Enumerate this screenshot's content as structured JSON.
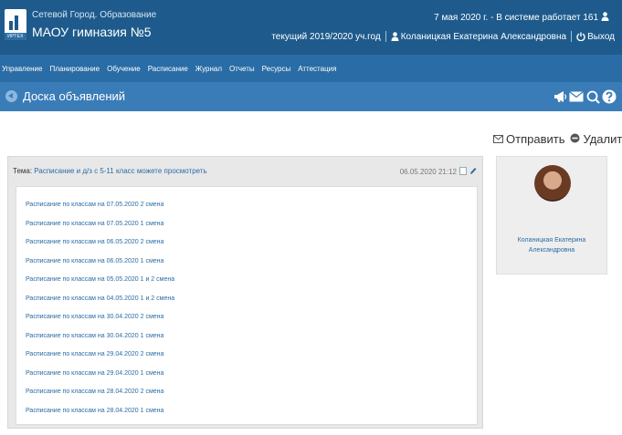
{
  "header": {
    "app_name": "Сетевой Город. Образование",
    "logo_text": "ИРТЕХ",
    "school_name": "МАОУ гимназия №5",
    "status_text": "7 мая 2020 г. - В системе работает 161",
    "academic_year": "текущий 2019/2020 уч.год",
    "user_name": "Коланицкая Екатерина Александровна",
    "logout_label": "Выход"
  },
  "menu": {
    "items": [
      "Управление",
      "Планирование",
      "Обучение",
      "Расписание",
      "Журнал",
      "Отчеты",
      "Ресурсы",
      "Аттестация"
    ]
  },
  "page": {
    "title": "Доска объявлений"
  },
  "actions": {
    "send_label": "Отправить",
    "delete_label": "Удалить"
  },
  "announcement": {
    "topic_label": "Тема:",
    "topic": "Расписание и д/з с 5-11 класс можете просмотреть",
    "date": "06.05.2020 21:12",
    "links": [
      "Расписание по классам на 07.05.2020 2 смена",
      "Расписание по классам на 07.05.2020 1 смена",
      "Расписание по классам на 06.05.2020 2 смена",
      "Расписание по классам на 06.05.2020 1 смена",
      "Расписание по классам на 05.05.2020 1 и 2 смена",
      "Расписание по классам на 04.05.2020 1 и 2 смена",
      "Расписание по классам на 30.04.2020 2 смена",
      "Расписание по классам на 30.04.2020 1 смена",
      "Расписание по классам на 29.04.2020 2 смена",
      "Расписание по классам на 29.04.2020 1 смена",
      "Расписание по классам на 28.04.2020 2 смена",
      "Расписание по классам на 28.04.2020 1 смена"
    ]
  },
  "author": {
    "name": "Коланицкая Екатерина Александровна"
  },
  "icons": {
    "back": "back-arrow-icon",
    "megaphone": "megaphone-icon",
    "mail": "mail-icon",
    "chat": "chat-icon",
    "help": "help-icon",
    "user": "user-icon",
    "power": "power-icon",
    "send": "envelope-icon",
    "delete": "minus-circle-icon",
    "attachment": "attachment-icon",
    "edit": "pencil-icon"
  },
  "colors": {
    "header_bg": "#1e5b8c",
    "menu_bg": "#2a6ca5",
    "titlebar_bg": "#3a7cb7",
    "link": "#2a6ca5"
  }
}
